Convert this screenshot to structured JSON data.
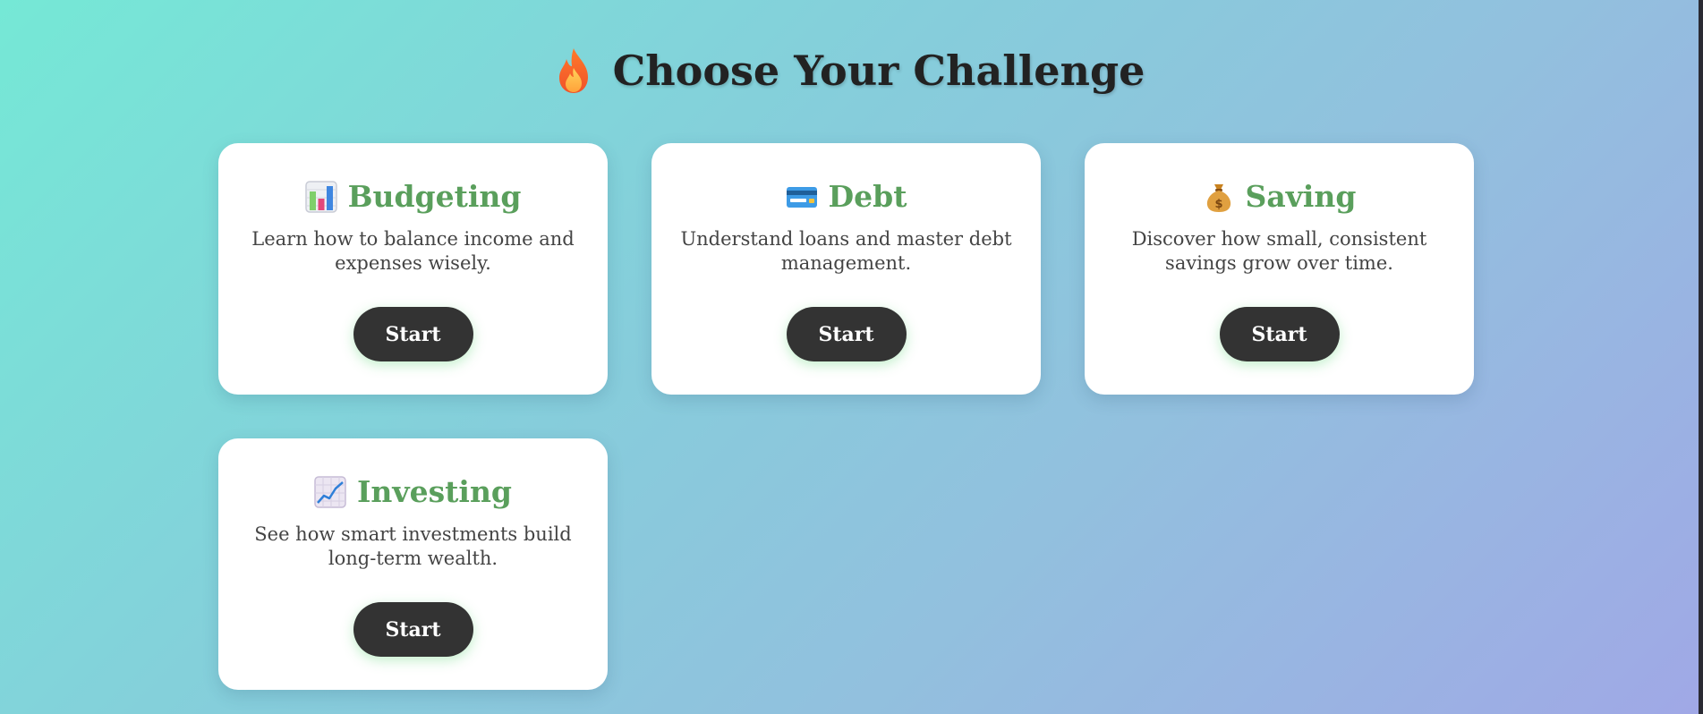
{
  "header": {
    "title": "Choose Your Challenge",
    "icon": "fire-icon"
  },
  "challenges": [
    {
      "icon": "bar-chart-icon",
      "name": "Budgeting",
      "description": "Learn how to balance income and expenses wisely.",
      "button_label": "Start"
    },
    {
      "icon": "credit-card-icon",
      "name": "Debt",
      "description": "Understand loans and master debt management.",
      "button_label": "Start"
    },
    {
      "icon": "money-bag-icon",
      "name": "Saving",
      "description": "Discover how small, consistent savings grow over time.",
      "button_label": "Start"
    },
    {
      "icon": "chart-increasing-icon",
      "name": "Investing",
      "description": "See how smart investments build long-term wealth.",
      "button_label": "Start"
    }
  ],
  "colors": {
    "accent_green": "#5a9f5c",
    "button_dark": "#333333",
    "title_text": "#222222"
  }
}
